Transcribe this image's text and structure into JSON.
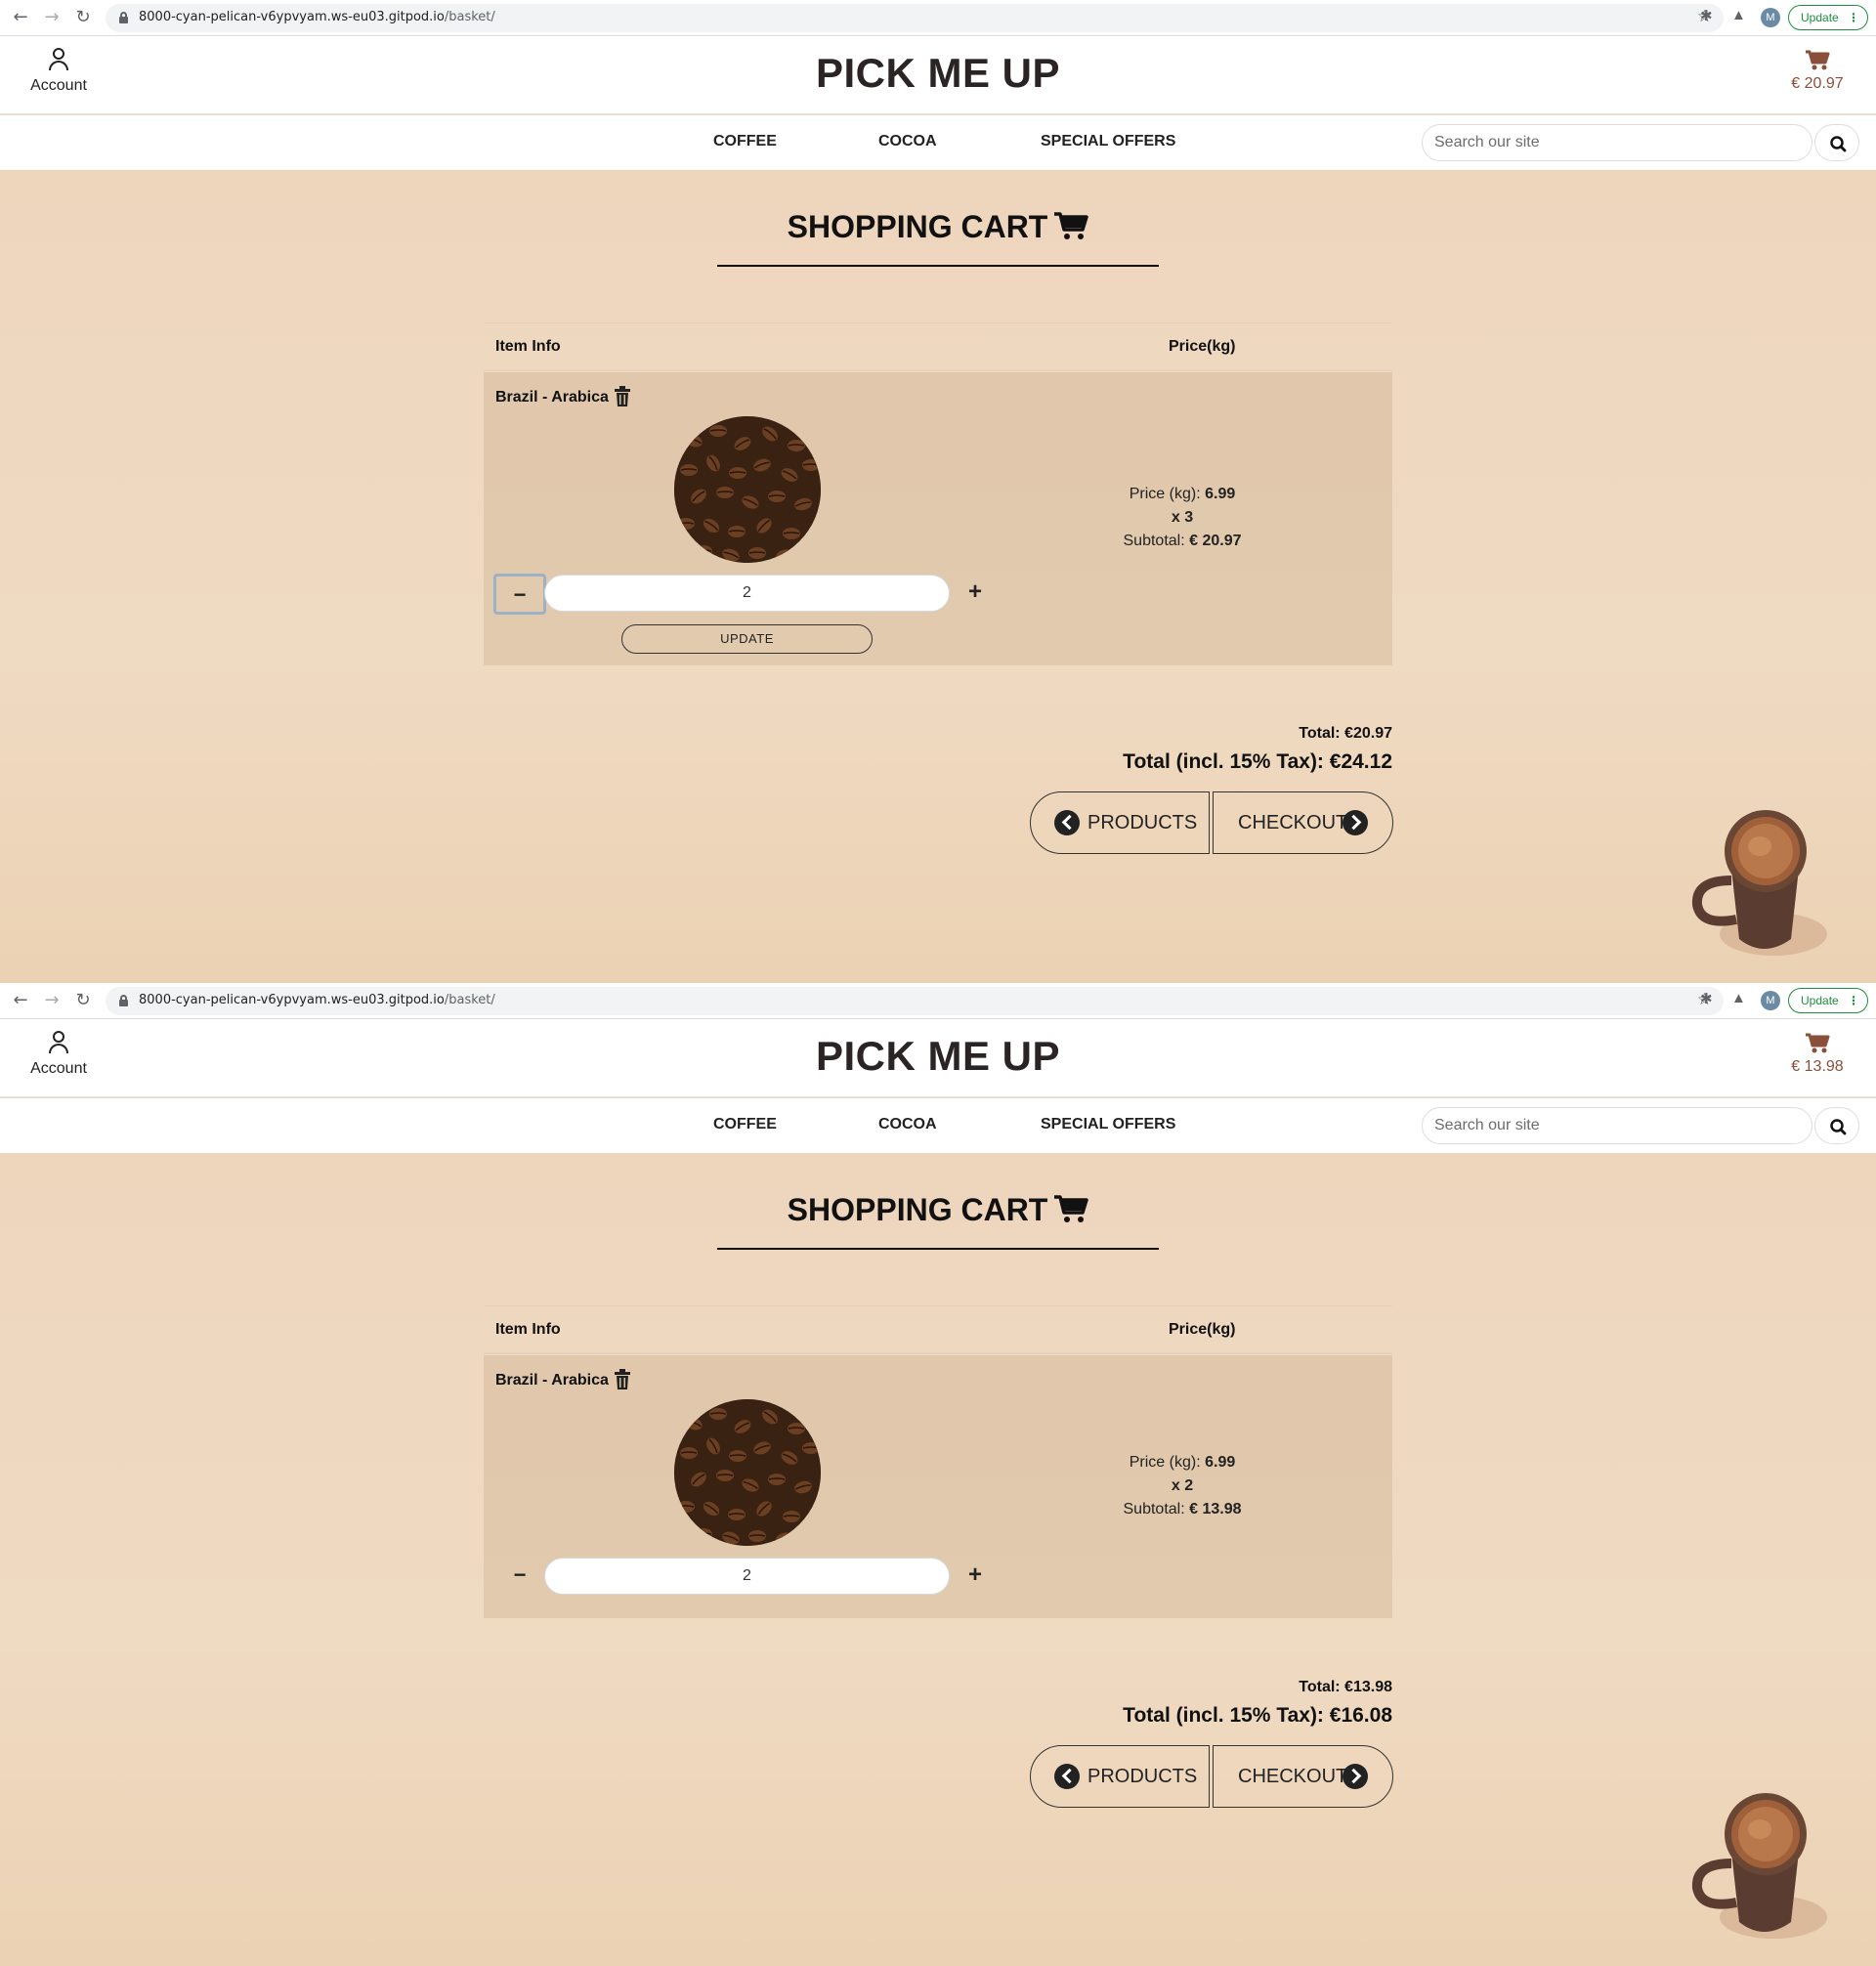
{
  "shared": {
    "browser": {
      "url_host": "8000-cyan-pelican-v6ypvyam.ws-eu03.gitpod.io",
      "url_path": "/basket/",
      "profile_initial": "M",
      "update_label": "Update"
    },
    "header": {
      "account_label": "Account",
      "logo": "PICK ME UP"
    },
    "nav": {
      "coffee": "COFFEE",
      "cocoa": "COCOA",
      "offers": "SPECIAL OFFERS",
      "search_placeholder": "Search our site"
    },
    "page_title": "SHOPPING CART",
    "table": {
      "col_item": "Item Info",
      "col_price": "Price(kg)"
    },
    "item_name": "Brazil - Arabica",
    "price_label": "Price (kg):",
    "price_value": "6.99",
    "subtotal_label": "Subtotal:",
    "buttons": {
      "products": "PRODUCTS",
      "checkout": "CHECKOUT",
      "update": "UPDATE"
    },
    "colors": {
      "cart_accent": "#8a4f3a",
      "page_background": "#efd9c0",
      "update_green": "#1e8e3e"
    }
  },
  "screens": [
    {
      "cart_total": "€ 20.97",
      "quantity_text": "x 3",
      "subtotal_value": "€ 20.97",
      "qty_input": "2",
      "show_update": true,
      "total_label": "Total: €20.97",
      "grand_total_label": "Total (incl. 15% Tax): €24.12"
    },
    {
      "cart_total": "€ 13.98",
      "quantity_text": "x 2",
      "subtotal_value": "€ 13.98",
      "qty_input": "2",
      "show_update": false,
      "total_label": "Total: €13.98",
      "grand_total_label": "Total (incl. 15% Tax): €16.08"
    }
  ]
}
